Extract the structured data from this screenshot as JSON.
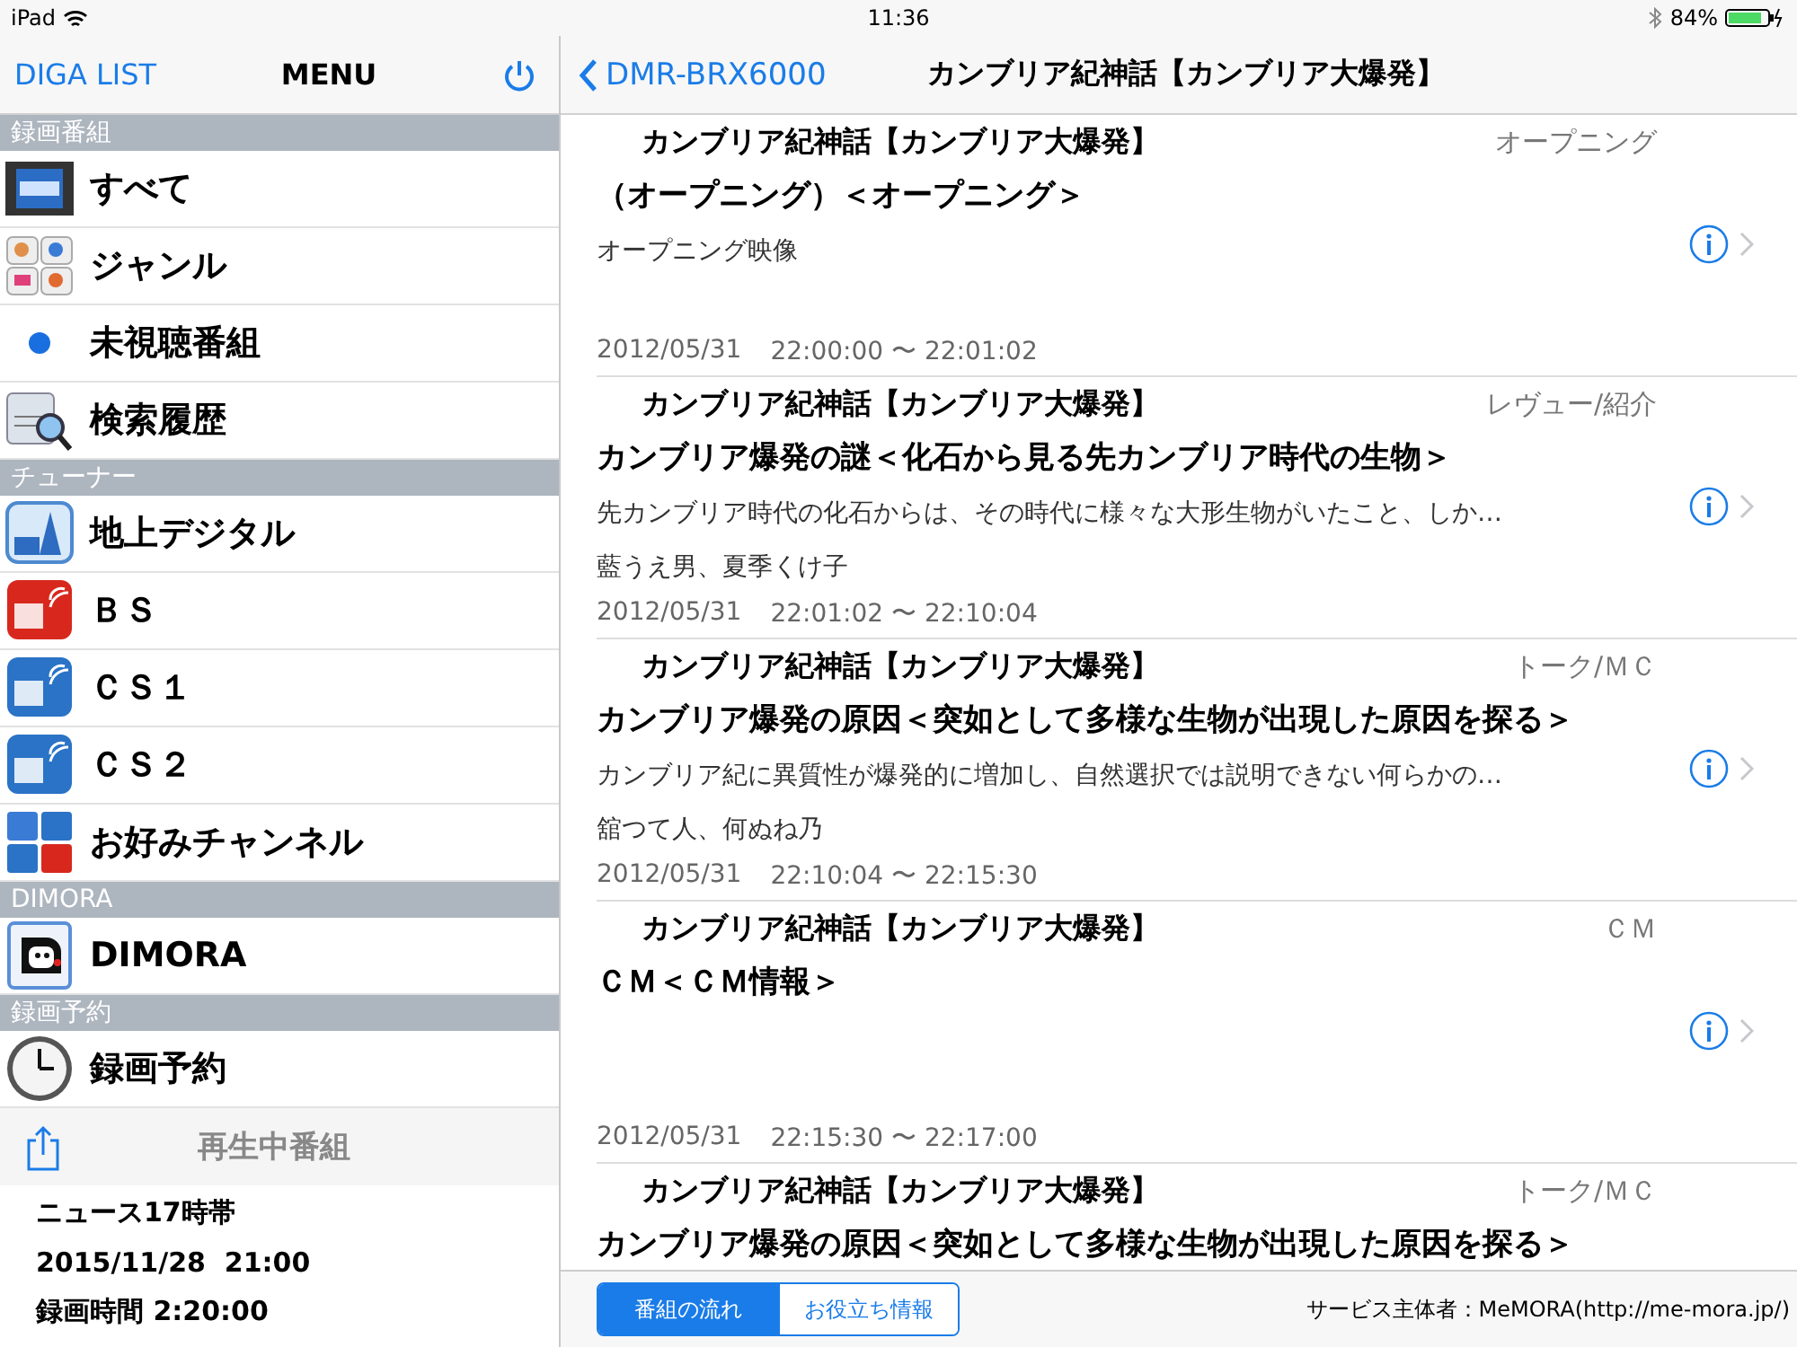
{
  "status_bar": {
    "carrier": "iPad",
    "time": "11:36",
    "battery": "84%"
  },
  "sidebar": {
    "nav": {
      "back": "DIGA LIST",
      "title": "MENU"
    },
    "sections": [
      {
        "header": "録画番組",
        "items": [
          {
            "label": "すべて",
            "kind": "all"
          },
          {
            "label": "ジャンル",
            "kind": "genre"
          },
          {
            "label": "未視聴番組",
            "kind": "dot"
          },
          {
            "label": "検索履歴",
            "kind": "search"
          }
        ]
      },
      {
        "header": "チューナー",
        "items": [
          {
            "label": "地上デジタル",
            "kind": "terrestrial"
          },
          {
            "label": "ＢＳ",
            "kind": "bs"
          },
          {
            "label": "ＣＳ１",
            "kind": "cs"
          },
          {
            "label": "ＣＳ２",
            "kind": "cs"
          },
          {
            "label": "お好みチャンネル",
            "kind": "favorite"
          }
        ]
      },
      {
        "header": "DIMORA",
        "items": [
          {
            "label": "DIMORA",
            "kind": "dimora"
          }
        ]
      },
      {
        "header": "録画予約",
        "items": [
          {
            "label": "録画予約",
            "kind": "clock"
          }
        ]
      }
    ],
    "now_playing": {
      "title": "再生中番組",
      "lines": [
        "ニュース17時帯",
        "2015/11/28  21:00",
        "録画時間 2:20:00"
      ]
    }
  },
  "main": {
    "nav": {
      "back": "DMR-BRX6000",
      "title": "カンブリア紀神話【カンブリア大爆発】"
    },
    "rows": [
      {
        "series": "カンブリア紀神話【カンブリア大爆発】",
        "genre": "オープニング",
        "title": "（オープニング）＜オープニング＞",
        "description": "オープニング映像",
        "date": "2012/05/31",
        "time": "22:00:00 〜 22:01:02",
        "info": true
      },
      {
        "series": "カンブリア紀神話【カンブリア大爆発】",
        "genre": "レヴュー/紹介",
        "title": "カンブリア爆発の謎＜化石から見る先カンブリア時代の生物＞",
        "description": "先カンブリア時代の化石からは、その時代に様々な大形生物がいたこと、しか…",
        "cast": "藍うえ男、夏季くけ子",
        "date": "2012/05/31",
        "time": "22:01:02 〜 22:10:04",
        "info": true
      },
      {
        "series": "カンブリア紀神話【カンブリア大爆発】",
        "genre": "トーク/ＭＣ",
        "title": "カンブリア爆発の原因＜突如として多様な生物が出現した原因を探る＞",
        "description": "カンブリア紀に異質性が爆発的に増加し、自然選択では説明できない何らかの…",
        "cast": "舘つて人、何ぬね乃",
        "date": "2012/05/31",
        "time": "22:10:04 〜 22:15:30",
        "info": true
      },
      {
        "series": "カンブリア紀神話【カンブリア大爆発】",
        "genre": "ＣＭ",
        "title": "ＣＭ＜ＣＭ情報＞",
        "date": "2012/05/31",
        "time": "22:15:30 〜 22:17:00",
        "info": true
      },
      {
        "series": "カンブリア紀神話【カンブリア大爆発】",
        "genre": "トーク/ＭＣ",
        "title": "カンブリア爆発の原因＜突如として多様な生物が出現した原因を探る＞",
        "info": false
      }
    ],
    "footer": {
      "tabs": [
        {
          "label": "番組の流れ",
          "selected": true
        },
        {
          "label": "お役立ち情報",
          "selected": false
        }
      ],
      "credit": "サービス主体者：MeMORA(http://me-mora.jp/)"
    }
  }
}
